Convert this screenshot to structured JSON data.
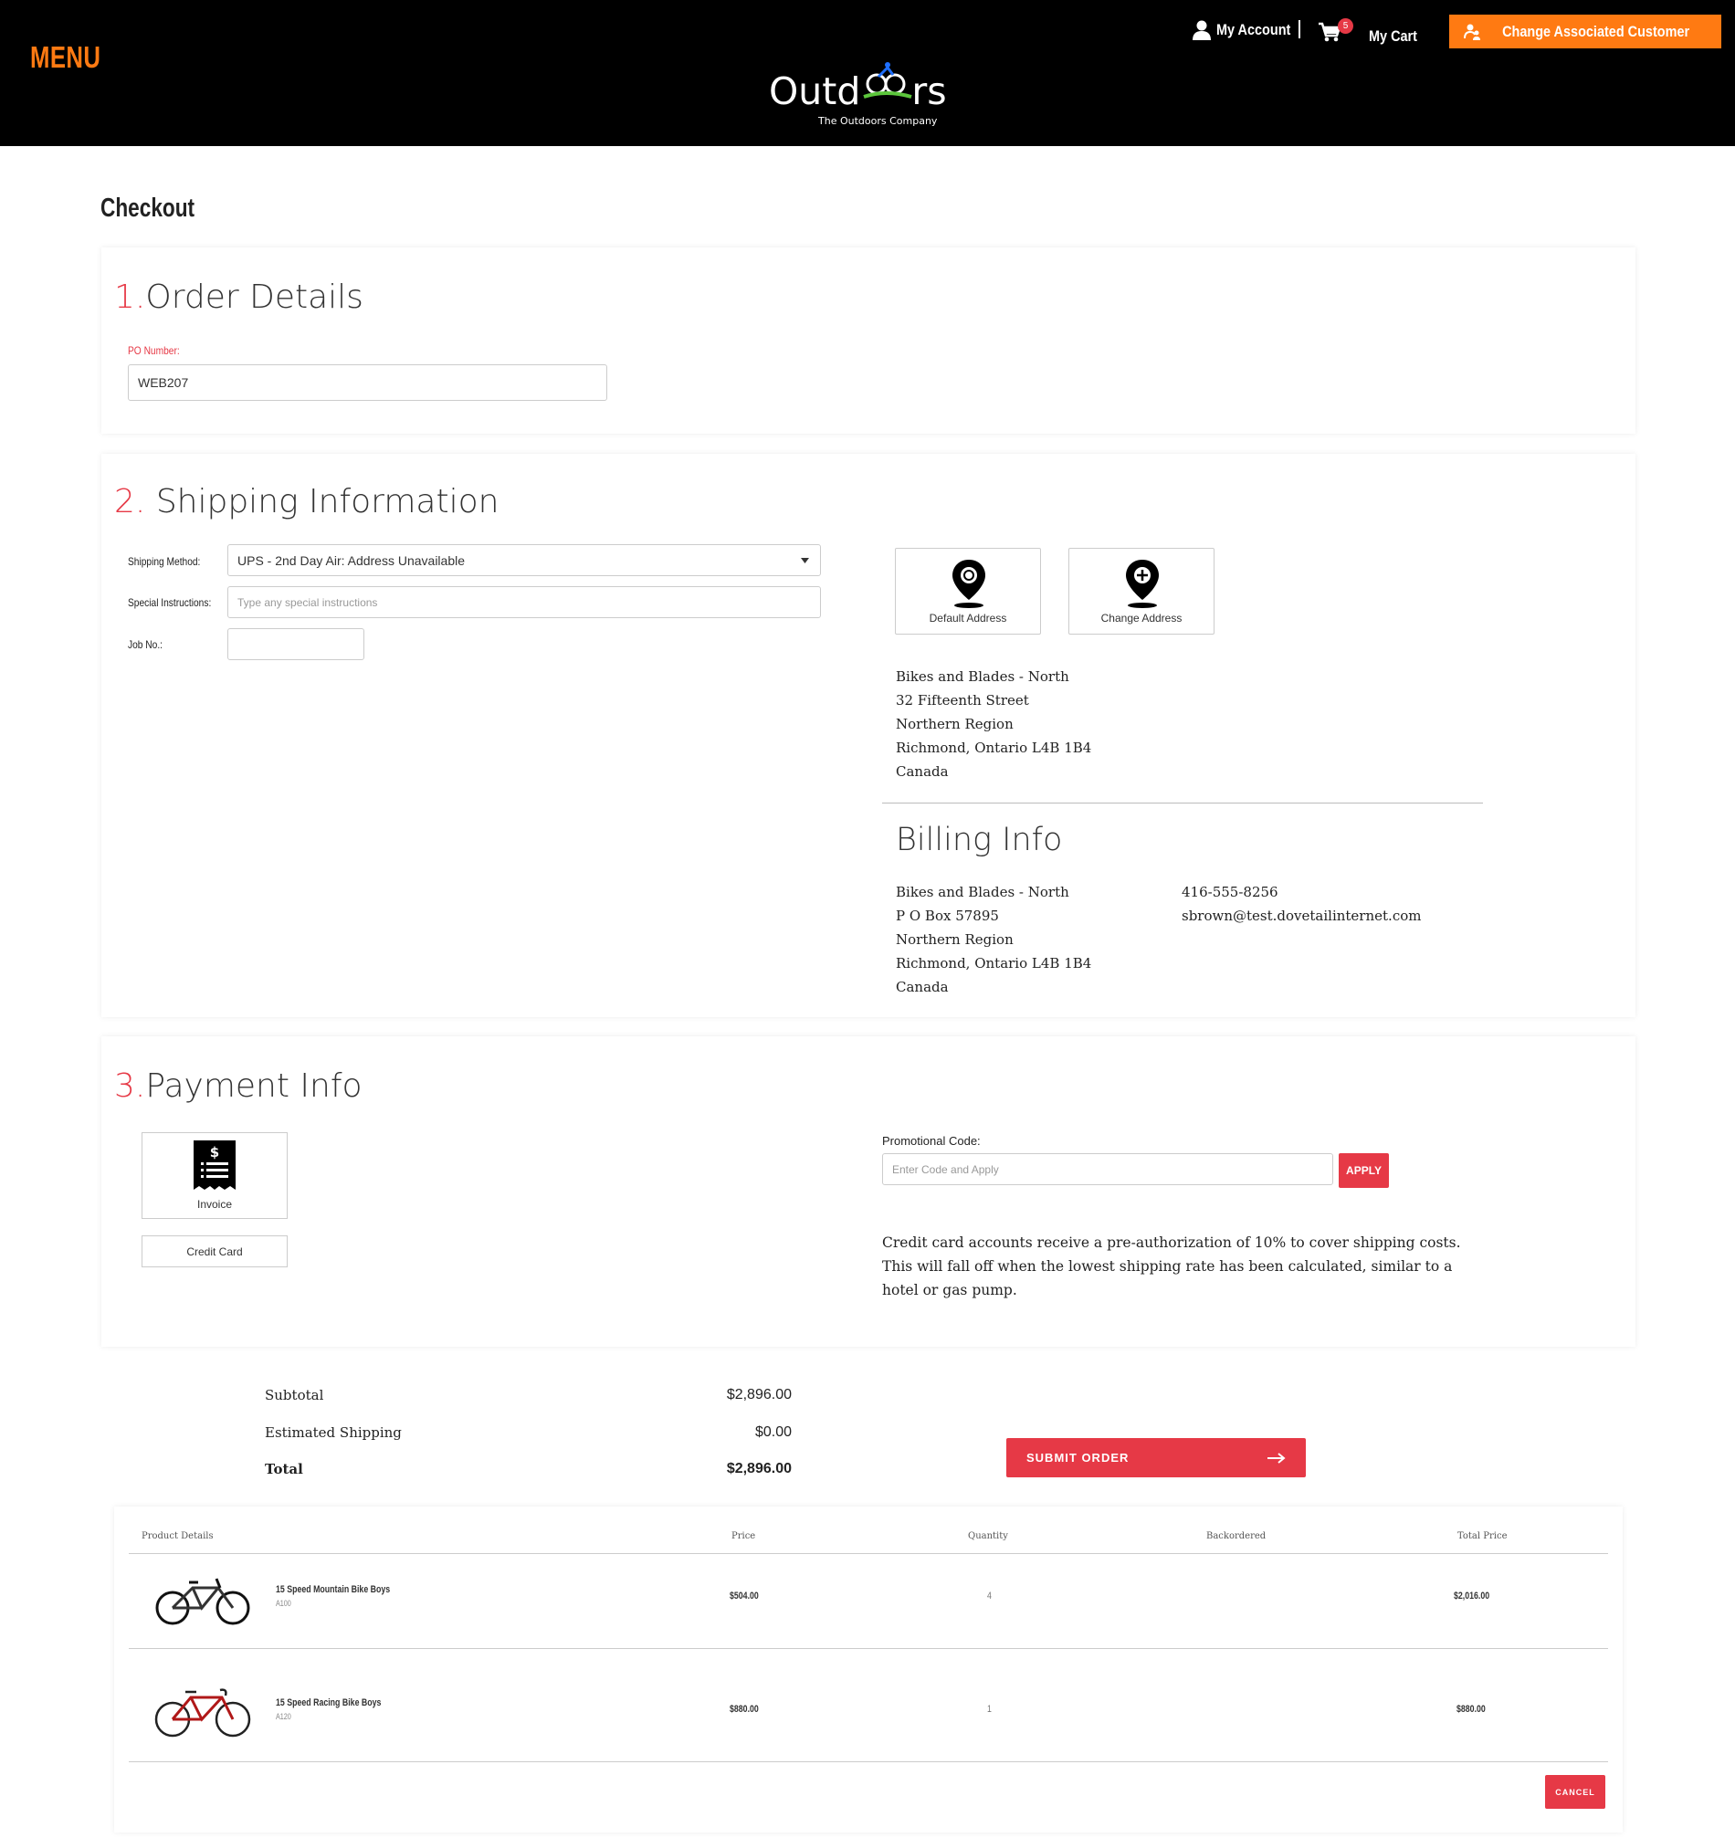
{
  "header": {
    "menu_label": "MENU",
    "account_label": "My Account",
    "cart_label": "My Cart",
    "cart_count": "5",
    "assoc_label": "Change Associated Customer",
    "logo_text": "Outd",
    "logo_text_tail": "rs",
    "logo_sub": "The Outdoors Company"
  },
  "page": {
    "title": "Checkout"
  },
  "order": {
    "num": "1.",
    "title": "Order Details",
    "po_label": "PO Number:",
    "po_value": "WEB207"
  },
  "shipping": {
    "num": "2.",
    "title": "Shipping Information",
    "method_label": "Shipping Method:",
    "method_value": "UPS - 2nd Day Air: Address Unavailable",
    "instructions_label": "Special Instructions:",
    "instructions_placeholder": "Type any special instructions",
    "job_label": "Job No.:",
    "job_value": "",
    "default_address_label": "Default Address",
    "change_address_label": "Change Address",
    "address": [
      "Bikes and Blades - North",
      "32 Fifteenth Street",
      "Northern Region",
      "Richmond, Ontario L4B 1B4",
      "Canada"
    ]
  },
  "billing": {
    "title": "Billing Info",
    "address": [
      "Bikes and Blades - North",
      "P O Box 57895",
      "Northern Region",
      "Richmond, Ontario L4B 1B4",
      "Canada"
    ],
    "phone": "416-555-8256",
    "email": "sbrown@test.dovetailinternet.com"
  },
  "payment": {
    "num": "3.",
    "title": "Payment Info",
    "invoice_label": "Invoice",
    "credit_card_label": "Credit Card",
    "promo_label": "Promotional Code:",
    "promo_placeholder": "Enter Code and Apply",
    "apply_label": "APPLY",
    "notice_lines": [
      "Credit card accounts receive a pre-authorization of 10% to cover shipping costs.",
      "This will fall off when the lowest shipping rate has been calculated, similar to a",
      "hotel or gas pump."
    ]
  },
  "totals": {
    "subtotal_label": "Subtotal",
    "subtotal": "$2,896.00",
    "shipping_label": "Estimated Shipping",
    "shipping": "$0.00",
    "total_label": "Total",
    "total": "$2,896.00",
    "submit_label": "SUBMIT ORDER"
  },
  "cart_table": {
    "headers": {
      "details": "Product Details",
      "price": "Price",
      "quantity": "Quantity",
      "backordered": "Backordered",
      "total": "Total Price"
    },
    "rows": [
      {
        "name": "15 Speed Mountain Bike Boys",
        "sku": "A100",
        "price": "$504.00",
        "quantity": "4",
        "backordered": "",
        "total": "$2,016.00"
      },
      {
        "name": "15 Speed Racing Bike Boys",
        "sku": "A120",
        "price": "$880.00",
        "quantity": "1",
        "backordered": "",
        "total": "$880.00"
      }
    ],
    "cancel_label": "CANCEL"
  },
  "colors": {
    "accent_orange": "#ff7a12",
    "accent_red": "#e63946",
    "header_bg": "#000000"
  }
}
